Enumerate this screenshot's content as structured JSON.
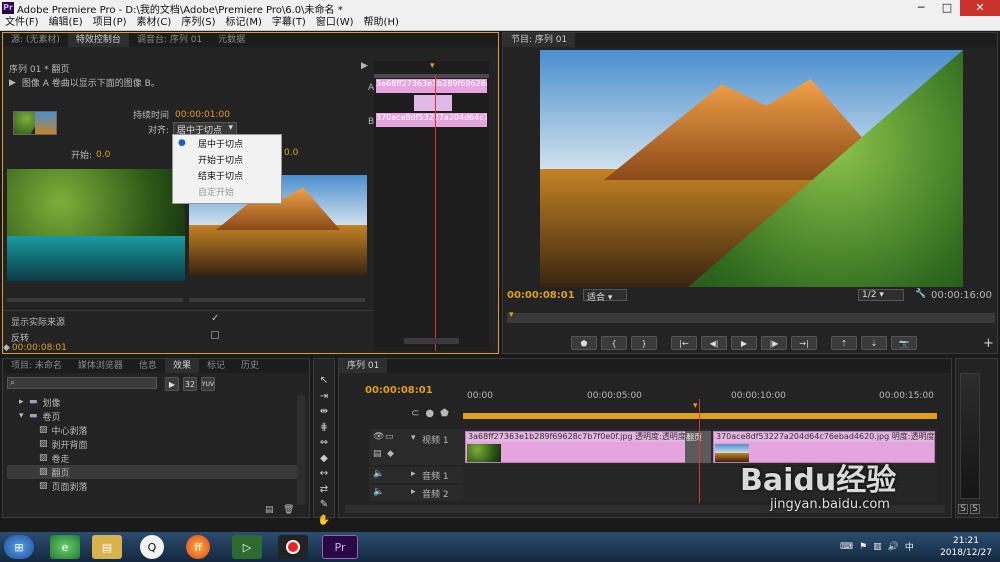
{
  "title_bar": {
    "title": "Adobe Premiere Pro - D:\\我的文档\\Adobe\\Premiere Pro\\6.0\\未命名 *"
  },
  "menu": [
    "文件(F)",
    "编辑(E)",
    "项目(P)",
    "素材(C)",
    "序列(S)",
    "标记(M)",
    "字幕(T)",
    "窗口(W)",
    "帮助(H)"
  ],
  "source_panel": {
    "tabs": [
      "源: (无素材)",
      "特效控制台",
      "调音台: 序列 01",
      "元数据"
    ],
    "active_tab": "特效控制台",
    "sequence_label": "序列 01 * 翻页",
    "effect_desc": "图像 A 卷曲以显示下面的图像 B。",
    "duration_label": "持续时间",
    "duration_value": "00:00:01:00",
    "align_label": "对齐:",
    "align_value": "居中于切点",
    "align_options": [
      "居中于切点",
      "开始于切点",
      "结束于切点",
      "自定开始"
    ],
    "start_label": "开始:",
    "start_value": "0.0",
    "end_value": "0.0",
    "show_source_label": "显示实际来源",
    "reverse_label": "反转",
    "timecode": "00:00:08:01",
    "mini_clip_a": "3a68ff27363e1b289f69628c7b7f0e0f.jpg",
    "mini_clip_b": "370ace8df53227a204d64c76ebad4620.jpg",
    "track_a": "A",
    "track_b": "B"
  },
  "program_panel": {
    "tab": "节目: 序列 01",
    "timecode": "00:00:08:01",
    "fit_value": "适合",
    "scale_value": "1/2",
    "duration": "00:00:16:00"
  },
  "project_panel": {
    "tabs": [
      "项目: 未命名",
      "媒体浏览器",
      "信息",
      "效果",
      "标记",
      "历史"
    ],
    "active_tab": "效果",
    "badges": [
      "32",
      "YUV"
    ],
    "tree": [
      {
        "label": "划像",
        "level": 1
      },
      {
        "label": "卷页",
        "level": 1
      },
      {
        "label": "中心剥落",
        "level": 2
      },
      {
        "label": "剥开背面",
        "level": 2
      },
      {
        "label": "卷走",
        "level": 2
      },
      {
        "label": "翻页",
        "level": 2,
        "selected": true
      },
      {
        "label": "页面剥落",
        "level": 2
      }
    ]
  },
  "timeline_panel": {
    "tab": "序列 01",
    "timecode": "00:00:08:01",
    "ruler": [
      "00:00",
      "00:00:05:00",
      "00:00:10:00",
      "00:00:15:00"
    ],
    "tracks": {
      "video1": "视频 1",
      "audio1": "音频 1",
      "audio2": "音频 2"
    },
    "clip1": {
      "name": "3a68ff27363e1b289f69628c7b7f0e0f.jpg",
      "fx": "透明度:透明度"
    },
    "transition": "翻页",
    "clip2": {
      "name": "370ace8df53227a204d64c76ebad4620.jpg",
      "fx": "明度:透明度"
    }
  },
  "meter": {
    "s1": "S",
    "s2": "S"
  },
  "watermark": {
    "brand": "Baidu经验",
    "url": "jingyan.baidu.com"
  },
  "taskbar": {
    "time": "21:21",
    "date": "2018/12/27",
    "apps": [
      "start",
      "360-browser",
      "file-explorer",
      "qq",
      "firefox",
      "camtasia",
      "recorder",
      "premiere-pro"
    ]
  },
  "colors": {
    "accent_orange": "#e0a019",
    "clip_pink": "#e6a4de",
    "playhead_red": "#d33"
  }
}
